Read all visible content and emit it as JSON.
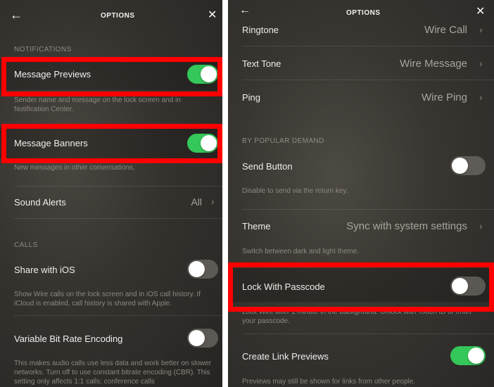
{
  "left": {
    "title": "OPTIONS",
    "section_notifications": "NOTIFICATIONS",
    "message_previews": {
      "label": "Message Previews",
      "enabled": true,
      "description": "Sender name and message on the lock screen and in Notification Center."
    },
    "message_banners": {
      "label": "Message Banners",
      "enabled": true,
      "description": "New messages in other conversations."
    },
    "sound_alerts": {
      "label": "Sound Alerts",
      "value": "All"
    },
    "section_calls": "CALLS",
    "share_with_ios": {
      "label": "Share with iOS",
      "enabled": false,
      "description": "Show Wire calls on the lock screen and in iOS call history. If iCloud is enabled, call history is shared with Apple."
    },
    "vbr": {
      "label": "Variable Bit Rate Encoding",
      "enabled": false,
      "description": "This makes audio calls use less data and work better on slower networks. Turn off to use constant bitrate encoding (CBR). This setting only affects 1:1 calls; conference calls"
    }
  },
  "right": {
    "title": "OPTIONS",
    "ringtone": {
      "label": "Ringtone",
      "value": "Wire Call"
    },
    "text_tone": {
      "label": "Text Tone",
      "value": "Wire Message"
    },
    "ping": {
      "label": "Ping",
      "value": "Wire Ping"
    },
    "section_popular": "BY POPULAR DEMAND",
    "send_button": {
      "label": "Send Button",
      "enabled": false,
      "description": "Disable to send via the return key."
    },
    "theme": {
      "label": "Theme",
      "value": "Sync with system settings",
      "description": "Switch between dark and light theme."
    },
    "lock_passcode": {
      "label": "Lock With Passcode",
      "enabled": false,
      "description": "Lock Wire after 1 minute in the background. Unlock with Touch ID or enter your passcode."
    },
    "link_previews": {
      "label": "Create Link Previews",
      "enabled": true,
      "description": "Previews may still be shown for links from other people."
    }
  },
  "icons": {
    "back": "←",
    "close": "✕",
    "chevron": "›"
  },
  "colors": {
    "toggle_on": "#34c759",
    "highlight": "#ff0000"
  }
}
